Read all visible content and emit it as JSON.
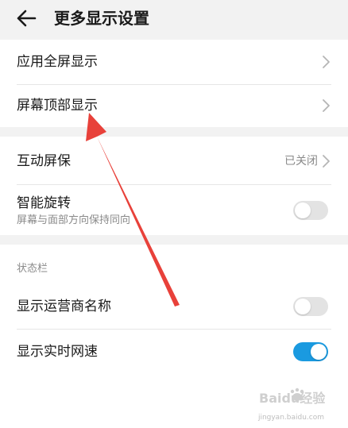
{
  "header": {
    "title": "更多显示设置"
  },
  "group1": [
    {
      "label": "应用全屏显示"
    },
    {
      "label": "屏幕顶部显示"
    }
  ],
  "group2": {
    "interactive_screensaver": {
      "label": "互动屏保",
      "value": "已关闭"
    },
    "smart_rotation": {
      "label": "智能旋转",
      "sub": "屏幕与面部方向保持同向",
      "enabled": false
    }
  },
  "status_bar": {
    "section_label": "状态栏",
    "carrier_name": {
      "label": "显示运营商名称",
      "enabled": false
    },
    "network_speed": {
      "label": "显示实时网速",
      "enabled": true
    }
  },
  "watermark": {
    "logo_text": "Baidu经验",
    "url": "jingyan.baidu.com"
  },
  "colors": {
    "accent": "#1a9ae0",
    "annotation_arrow": "#e8413a",
    "toggle_off": "#e3e3e3"
  }
}
